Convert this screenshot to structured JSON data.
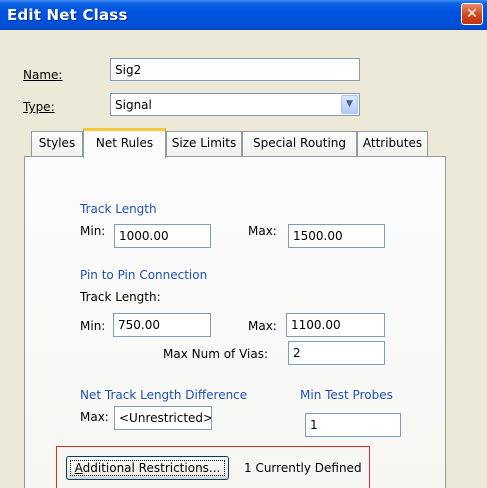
{
  "window": {
    "title": "Edit Net Class"
  },
  "form": {
    "name_label": "Name:",
    "name_value": "Sig2",
    "type_label": "Type:",
    "type_value": "Signal"
  },
  "tabs": [
    {
      "label": "Styles"
    },
    {
      "label": "Net Rules",
      "active": true
    },
    {
      "label": "Size Limits"
    },
    {
      "label": "Special Routing"
    },
    {
      "label": "Attributes"
    }
  ],
  "net_rules": {
    "track_length": {
      "heading": "Track Length",
      "min_label": "Min:",
      "min_value": "1000.00",
      "max_label": "Max:",
      "max_value": "1500.00"
    },
    "pin_to_pin": {
      "heading": "Pin to Pin Connection",
      "sub_label": "Track Length:",
      "min_label": "Min:",
      "min_value": "750.00",
      "max_label": "Max:",
      "max_value": "1100.00",
      "vias_label": "Max Num of Vias:",
      "vias_value": "2"
    },
    "diff": {
      "heading": "Net Track Length Difference",
      "max_label": "Max:",
      "max_value": "<Unrestricted>"
    },
    "probes": {
      "heading": "Min Test Probes",
      "value": "1"
    },
    "restrictions": {
      "button_label": "Additional Restrictions...",
      "status": "1 Currently Defined"
    }
  },
  "colors": {
    "section_heading": "#1f50b5",
    "highlight_frame": "#d23028",
    "title_bar": "#0053e1"
  }
}
